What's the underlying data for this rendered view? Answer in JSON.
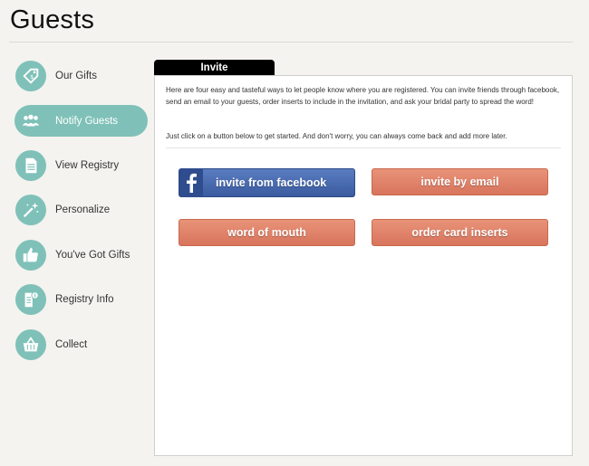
{
  "page": {
    "title": "Guests"
  },
  "sidebar": {
    "items": [
      {
        "label": "Our Gifts"
      },
      {
        "label": "Notify Guests"
      },
      {
        "label": "View Registry"
      },
      {
        "label": "Personalize"
      },
      {
        "label": "You've Got Gifts"
      },
      {
        "label": "Registry Info"
      },
      {
        "label": "Collect"
      }
    ],
    "active_index": 1
  },
  "panel": {
    "tab_label": "Invite",
    "intro": "Here are four easy and tasteful ways to let people know where you are registered. You can invite friends through facebook, send an email to your guests, order inserts to include in the invitation, and ask your bridal party to spread the word!",
    "hint": "Just click on a button below to get started. And don't worry, you can always come back and add more later.",
    "buttons": {
      "facebook": "invite from facebook",
      "email": "invite by email",
      "word_of_mouth": "word of mouth",
      "card_inserts": "order card inserts"
    }
  },
  "colors": {
    "accent_teal": "#7fc1b8",
    "button_salmon": "#de7b62",
    "facebook_blue": "#3a5ba0"
  }
}
